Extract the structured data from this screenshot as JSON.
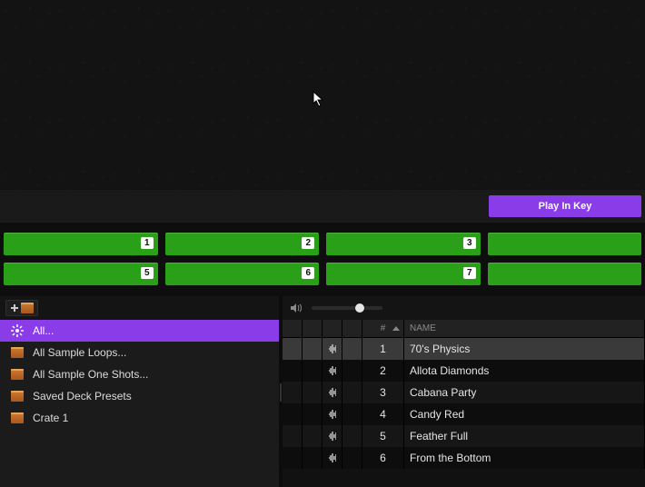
{
  "toolbar": {
    "play_in_key_label": "Play In Key"
  },
  "pads": {
    "row1": [
      "1",
      "2",
      "3",
      ""
    ],
    "row2": [
      "5",
      "6",
      "7",
      ""
    ]
  },
  "sidebar": {
    "items": [
      {
        "label": "All...",
        "icon": "spark",
        "active": true
      },
      {
        "label": "All Sample Loops...",
        "icon": "crate",
        "active": false
      },
      {
        "label": "All Sample One Shots...",
        "icon": "crate",
        "active": false
      },
      {
        "label": "Saved Deck Presets",
        "icon": "crate",
        "active": false
      },
      {
        "label": "Crate 1",
        "icon": "crate",
        "active": false
      }
    ]
  },
  "audition": {
    "volume": 70
  },
  "table": {
    "columns": {
      "num_header": "#",
      "name_header": "NAME"
    },
    "rows": [
      {
        "num": "1",
        "name": "70's Physics"
      },
      {
        "num": "2",
        "name": "Allota Diamonds"
      },
      {
        "num": "3",
        "name": "Cabana Party"
      },
      {
        "num": "4",
        "name": "Candy Red"
      },
      {
        "num": "5",
        "name": "Feather Full"
      },
      {
        "num": "6",
        "name": "From the Bottom"
      }
    ]
  }
}
